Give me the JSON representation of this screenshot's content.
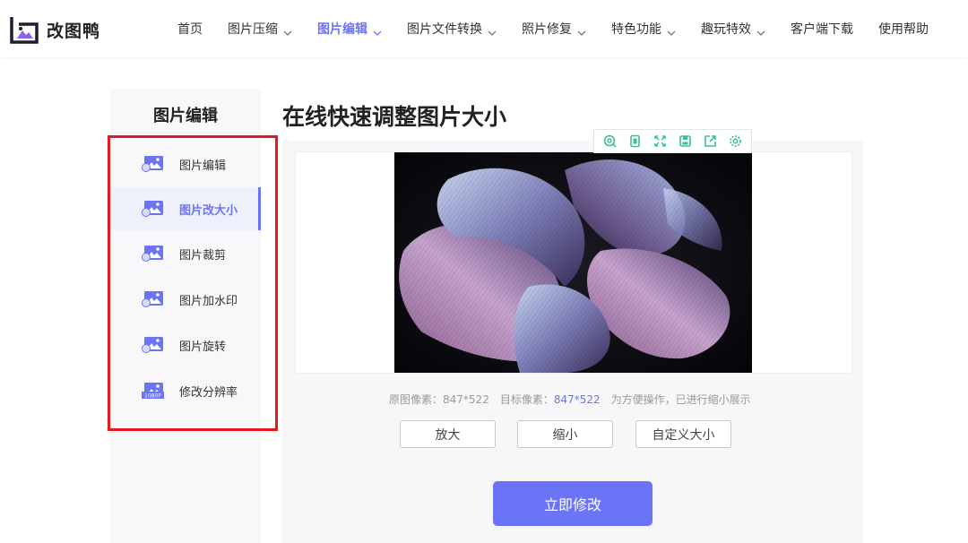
{
  "brand": {
    "name": "改图鸭"
  },
  "nav": [
    {
      "label": "首页",
      "dropdown": false
    },
    {
      "label": "图片压缩",
      "dropdown": true
    },
    {
      "label": "图片编辑",
      "dropdown": true,
      "active": true
    },
    {
      "label": "图片文件转换",
      "dropdown": true
    },
    {
      "label": "照片修复",
      "dropdown": true
    },
    {
      "label": "特色功能",
      "dropdown": true
    },
    {
      "label": "趣玩特效",
      "dropdown": true
    },
    {
      "label": "客户端下载",
      "dropdown": false
    },
    {
      "label": "使用帮助",
      "dropdown": false
    }
  ],
  "sidebar": {
    "title": "图片编辑",
    "items": [
      {
        "label": "图片编辑",
        "icon": "image-edit-icon"
      },
      {
        "label": "图片改大小",
        "icon": "image-resize-icon",
        "active": true
      },
      {
        "label": "图片裁剪",
        "icon": "image-crop-icon"
      },
      {
        "label": "图片加水印",
        "icon": "image-watermark-icon"
      },
      {
        "label": "图片旋转",
        "icon": "image-rotate-icon"
      },
      {
        "label": "修改分辨率",
        "icon": "resolution-1080p-icon",
        "badge": "1080P"
      }
    ]
  },
  "main": {
    "title": "在线快速调整图片大小",
    "toolbar": [
      "zoom-icon",
      "fit-icon",
      "fullscreen-icon",
      "save-icon",
      "export-icon",
      "settings-icon"
    ],
    "info": {
      "original_label": "原图像素：",
      "original_value": "847*522",
      "target_label": "目标像素：",
      "target_value": "847*522",
      "note": "为方便操作，已进行缩小展示"
    },
    "buttons": {
      "enlarge": "放大",
      "shrink": "缩小",
      "custom": "自定义大小"
    },
    "submit": "立即修改"
  },
  "colors": {
    "accent": "#6b73f7",
    "highlight_box": "#e8181f",
    "toolbar_icon": "#3ac28a"
  }
}
